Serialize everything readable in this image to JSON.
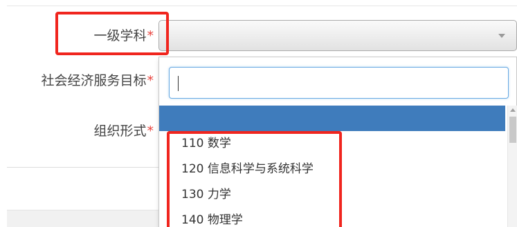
{
  "form": {
    "field_1_label": "一级学科",
    "field_2_label": "社会经济服务目标",
    "field_3_label": "组织形式",
    "required_marker": "*",
    "select_value": ""
  },
  "dropdown": {
    "search_value": "",
    "options": [
      {
        "label": ""
      },
      {
        "label": "110 数学"
      },
      {
        "label": "120 信息科学与系统科学"
      },
      {
        "label": "130 力学"
      },
      {
        "label": "140 物理学"
      }
    ]
  },
  "icons": {
    "select_arrow": "chevron-down-icon",
    "scroll_up": "arrow-up-icon"
  },
  "colors": {
    "required": "#e8413b",
    "highlight": "#3f7cbc",
    "focus_border": "#66a9e2",
    "annotation": "#f0251e"
  }
}
